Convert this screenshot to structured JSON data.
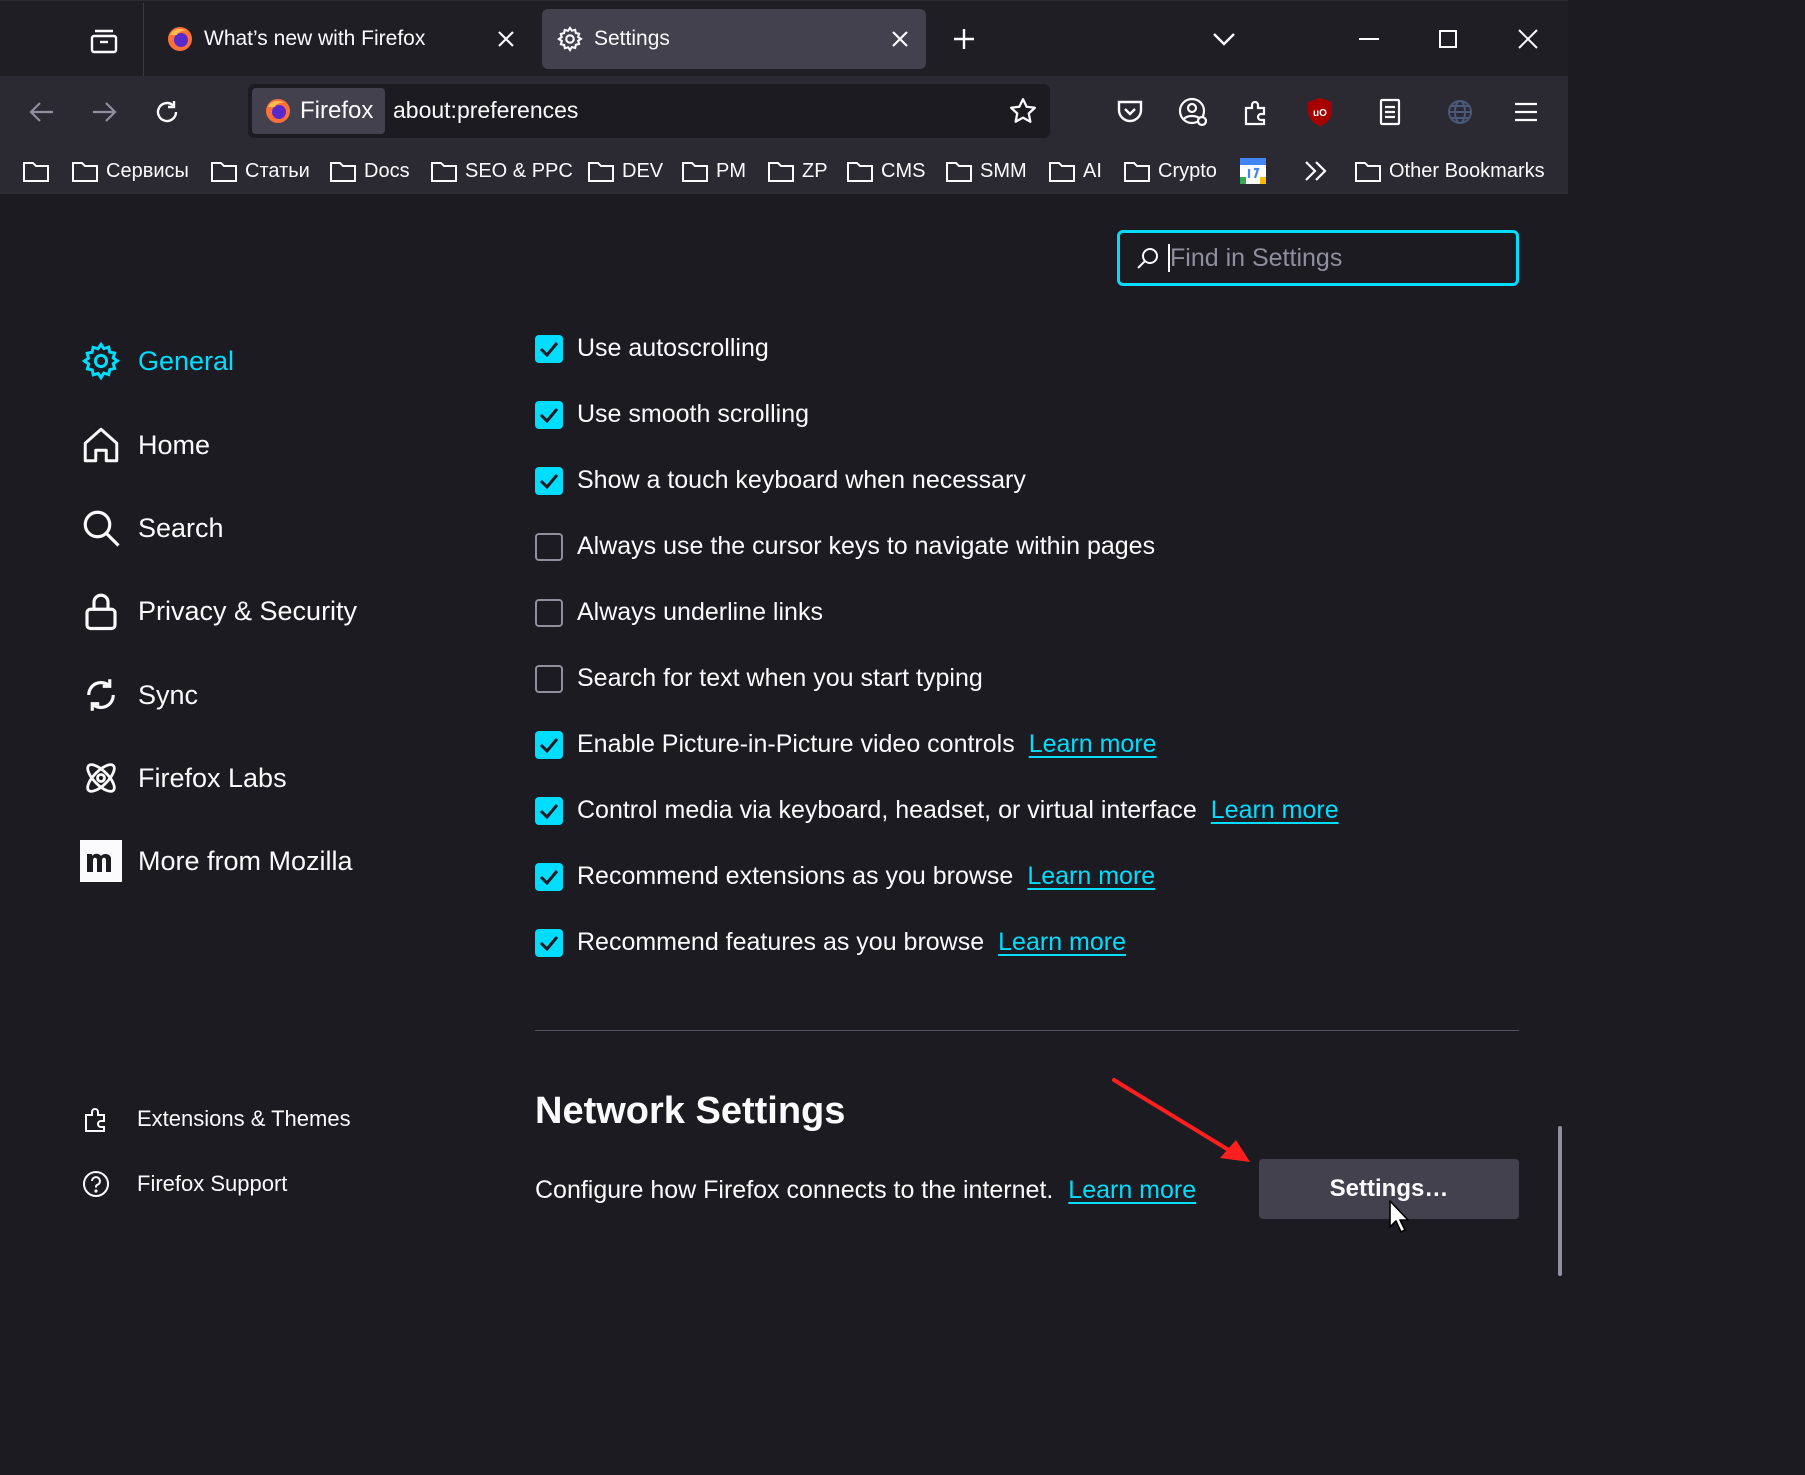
{
  "tabs": [
    {
      "label": "What’s new with Firefox",
      "icon": "firefox-logo-icon",
      "active": false
    },
    {
      "label": "Settings",
      "icon": "gear-icon",
      "active": true
    }
  ],
  "toolbar": {
    "identity_label": "Firefox",
    "url": "about:preferences"
  },
  "bookmarks": [
    {
      "label": ""
    },
    {
      "label": "Сервисы"
    },
    {
      "label": "Статьи"
    },
    {
      "label": "Docs"
    },
    {
      "label": "SEO & PPC"
    },
    {
      "label": "DEV"
    },
    {
      "label": "PM"
    },
    {
      "label": "ZP"
    },
    {
      "label": "CMS"
    },
    {
      "label": "SMM"
    },
    {
      "label": "AI"
    },
    {
      "label": "Crypto"
    },
    {
      "label": "Other Bookmarks"
    }
  ],
  "search": {
    "placeholder": "Find in Settings"
  },
  "categories": [
    {
      "label": "General",
      "icon": "gear-icon",
      "active": true
    },
    {
      "label": "Home",
      "icon": "home-icon"
    },
    {
      "label": "Search",
      "icon": "search-icon"
    },
    {
      "label": "Privacy & Security",
      "icon": "lock-icon"
    },
    {
      "label": "Sync",
      "icon": "sync-icon"
    },
    {
      "label": "Firefox Labs",
      "icon": "labs-atom-icon"
    },
    {
      "label": "More from Mozilla",
      "icon": "mozilla-m-icon"
    }
  ],
  "footer_links": [
    {
      "label": "Extensions & Themes",
      "icon": "puzzle-icon"
    },
    {
      "label": "Firefox Support",
      "icon": "help-icon"
    }
  ],
  "options": [
    {
      "label": "Use autoscrolling",
      "checked": true
    },
    {
      "label": "Use smooth scrolling",
      "checked": true
    },
    {
      "label": "Show a touch keyboard when necessary",
      "checked": true
    },
    {
      "label": "Always use the cursor keys to navigate within pages",
      "checked": false
    },
    {
      "label": "Always underline links",
      "checked": false
    },
    {
      "label": "Search for text when you start typing",
      "checked": false
    },
    {
      "label": "Enable Picture-in-Picture video controls",
      "checked": true,
      "link": "Learn more"
    },
    {
      "label": "Control media via keyboard, headset, or virtual interface",
      "checked": true,
      "link": "Learn more"
    },
    {
      "label": "Recommend extensions as you browse",
      "checked": true,
      "link": "Learn more"
    },
    {
      "label": "Recommend features as you browse",
      "checked": true,
      "link": "Learn more"
    }
  ],
  "network": {
    "title": "Network Settings",
    "description": "Configure how Firefox connects to the internet.",
    "link": "Learn more",
    "button": "Settings…"
  },
  "colors": {
    "accent": "#00ddff",
    "background": "#1c1b22",
    "toolbar": "#2b2a33",
    "annotation_arrow": "#ff1f1f"
  }
}
